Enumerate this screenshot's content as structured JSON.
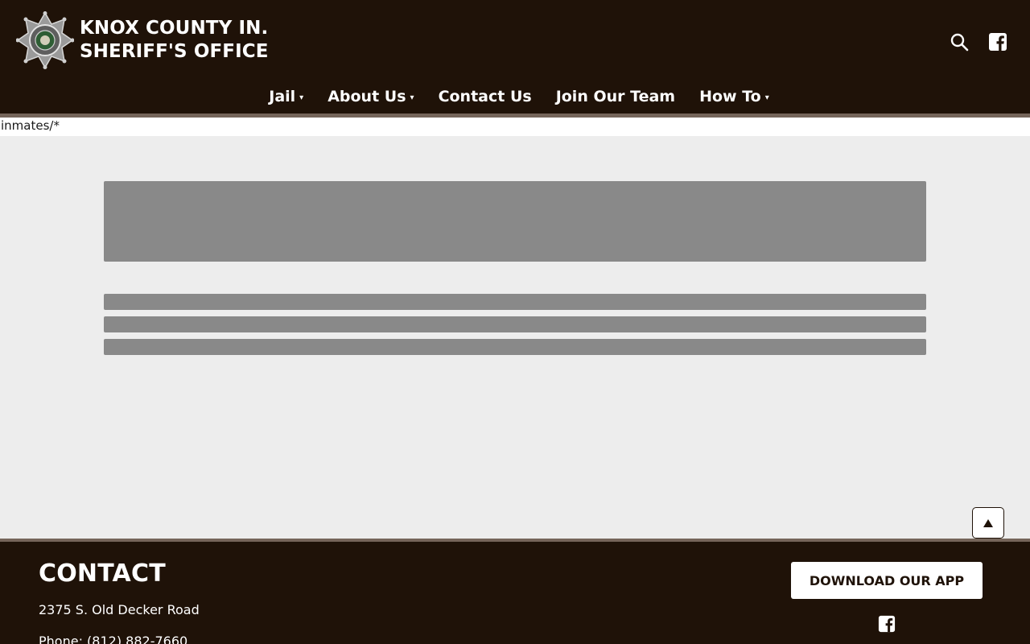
{
  "header": {
    "title_line1": "KNOX COUNTY IN.",
    "title_line2": "SHERIFF'S OFFICE",
    "logo_icon": "sheriff-star-badge-icon",
    "search_icon": "search-icon",
    "facebook_icon": "facebook-icon",
    "background_color": "#1f1208"
  },
  "nav": {
    "items": [
      {
        "label": "Jail",
        "has_dropdown": true
      },
      {
        "label": "About Us",
        "has_dropdown": true
      },
      {
        "label": "Contact Us",
        "has_dropdown": false
      },
      {
        "label": "Join Our Team",
        "has_dropdown": false
      },
      {
        "label": "How To",
        "has_dropdown": true
      }
    ],
    "dropdown_glyph": "▾"
  },
  "path_text": "inmates/*",
  "scroll_top": {
    "icon": "arrow-up-icon"
  },
  "footer": {
    "heading": "CONTACT",
    "address": "2375 S. Old Decker Road",
    "phone_label": "Phone:",
    "phone_number": "(812) 882-7660",
    "app_button_label": "DOWNLOAD OUR APP",
    "facebook_icon": "facebook-icon"
  }
}
